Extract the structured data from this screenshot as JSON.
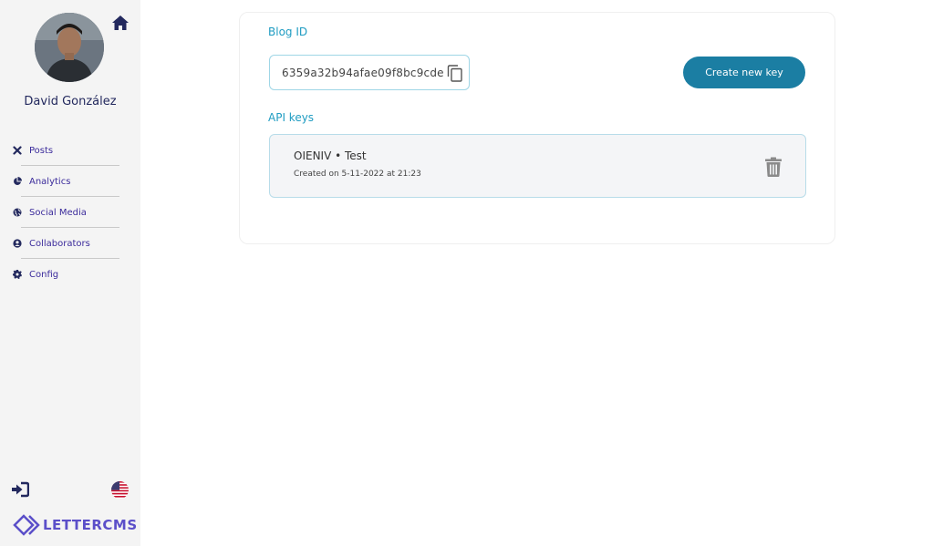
{
  "sidebar": {
    "user_name": "David González",
    "items": [
      {
        "label": "Posts",
        "icon": "close-x-icon"
      },
      {
        "label": "Analytics",
        "icon": "pie-chart-icon"
      },
      {
        "label": "Social Media",
        "icon": "globe-icon"
      },
      {
        "label": "Collaborators",
        "icon": "user-circle-icon"
      },
      {
        "label": "Config",
        "icon": "gear-icon"
      }
    ],
    "logo_text": "LETTERCMS"
  },
  "main": {
    "blog_id_label": "Blog ID",
    "blog_id_value": "6359a32b94afae09f8bc9cde",
    "create_button": "Create new key",
    "api_keys_label": "API keys",
    "api_keys": [
      {
        "name": "OIENIV • Test",
        "created": "Created on 5-11-2022 at 21:23"
      }
    ]
  },
  "colors": {
    "accent": "#1b7ea3",
    "label_blue": "#1f9cc2",
    "nav_text": "#3b2b9b",
    "logo": "#5b4fc9"
  }
}
